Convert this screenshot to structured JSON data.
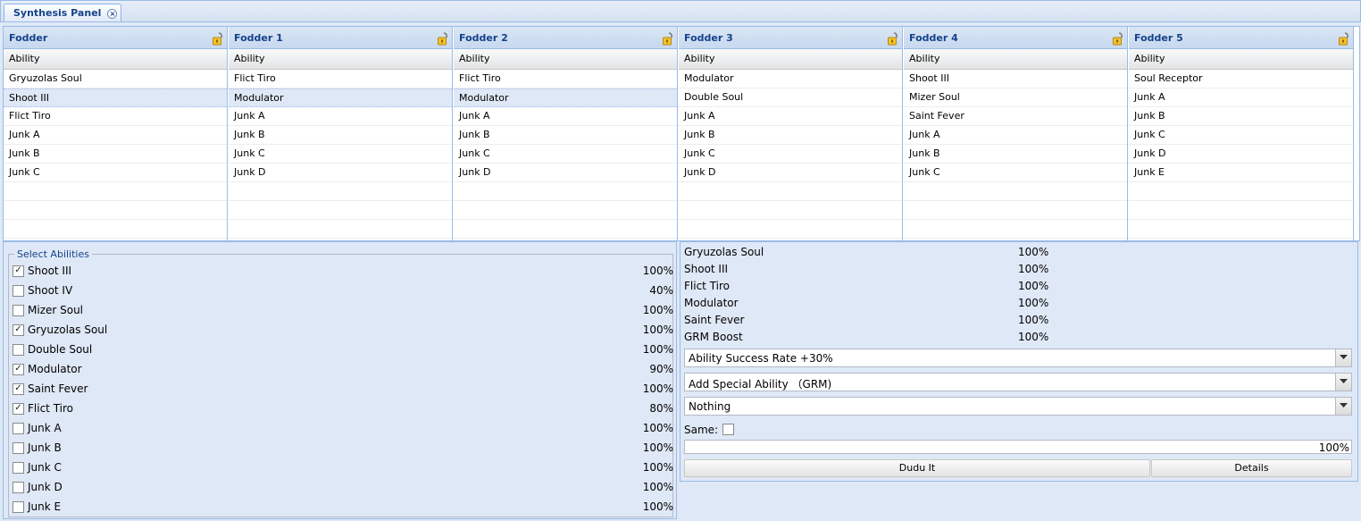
{
  "tab": {
    "title": "Synthesis Panel"
  },
  "grids": [
    {
      "title": "Fodder",
      "column": "Ability",
      "rows": [
        "Gryuzolas Soul",
        "Shoot III",
        "Flict Tiro",
        "Junk A",
        "Junk B",
        "Junk C"
      ]
    },
    {
      "title": "Fodder 1",
      "column": "Ability",
      "rows": [
        "Flict Tiro",
        "Modulator",
        "Junk A",
        "Junk B",
        "Junk C",
        "Junk D"
      ]
    },
    {
      "title": "Fodder 2",
      "column": "Ability",
      "rows": [
        "Flict Tiro",
        "Modulator",
        "Junk A",
        "Junk B",
        "Junk C",
        "Junk D"
      ]
    },
    {
      "title": "Fodder 3",
      "column": "Ability",
      "rows": [
        "Modulator",
        "Double Soul",
        "Junk A",
        "Junk B",
        "Junk C",
        "Junk D"
      ]
    },
    {
      "title": "Fodder 4",
      "column": "Ability",
      "rows": [
        "Shoot III",
        "Mizer Soul",
        "Saint Fever",
        "Junk A",
        "Junk B",
        "Junk C"
      ]
    },
    {
      "title": "Fodder 5",
      "column": "Ability",
      "rows": [
        "Soul Receptor",
        "Junk A",
        "Junk B",
        "Junk C",
        "Junk D",
        "Junk E"
      ]
    }
  ],
  "select_abilities": {
    "legend": "Select Abilities",
    "items": [
      {
        "label": "Shoot III",
        "pct": "100%",
        "checked": true
      },
      {
        "label": "Shoot IV",
        "pct": "40%",
        "checked": false
      },
      {
        "label": "Mizer Soul",
        "pct": "100%",
        "checked": false
      },
      {
        "label": "Gryuzolas Soul",
        "pct": "100%",
        "checked": true
      },
      {
        "label": "Double Soul",
        "pct": "100%",
        "checked": false
      },
      {
        "label": "Modulator",
        "pct": "90%",
        "checked": true
      },
      {
        "label": "Saint Fever",
        "pct": "100%",
        "checked": true
      },
      {
        "label": "Flict Tiro",
        "pct": "80%",
        "checked": true
      },
      {
        "label": "Junk A",
        "pct": "100%",
        "checked": false
      },
      {
        "label": "Junk B",
        "pct": "100%",
        "checked": false
      },
      {
        "label": "Junk C",
        "pct": "100%",
        "checked": false
      },
      {
        "label": "Junk D",
        "pct": "100%",
        "checked": false
      },
      {
        "label": "Junk E",
        "pct": "100%",
        "checked": false
      }
    ]
  },
  "results": [
    {
      "name": "Gryuzolas Soul",
      "pct": "100%"
    },
    {
      "name": "Shoot III",
      "pct": "100%"
    },
    {
      "name": "Flict Tiro",
      "pct": "100%"
    },
    {
      "name": "Modulator",
      "pct": "100%"
    },
    {
      "name": "Saint Fever",
      "pct": "100%"
    },
    {
      "name": "GRM Boost",
      "pct": "100%"
    }
  ],
  "combos": [
    {
      "value": "Ability Success Rate +30%"
    },
    {
      "value": "Add Special Ability （GRM)"
    },
    {
      "value": "Nothing"
    }
  ],
  "same_label": "Same:",
  "progress": {
    "text": "100%",
    "value": 1.0
  },
  "buttons": {
    "dudu": "Dudu It",
    "details": "Details"
  },
  "colors": {
    "accent": "#15428b",
    "border": "#99bbe8",
    "panel_bg": "#dfe8f6",
    "selected_row": "#dfe8f6"
  }
}
